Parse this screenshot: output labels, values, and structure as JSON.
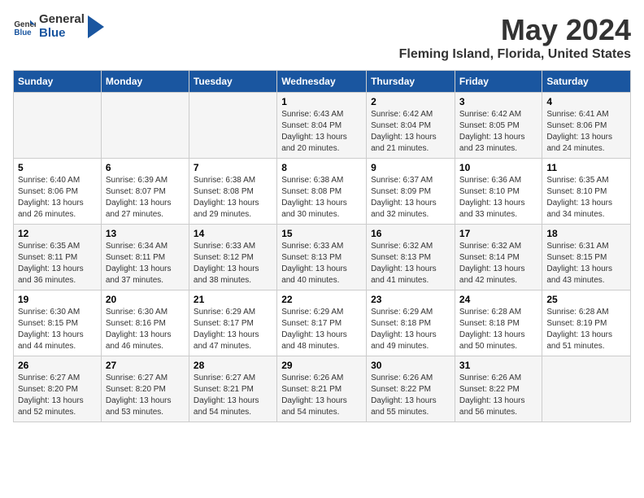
{
  "header": {
    "logo_general": "General",
    "logo_blue": "Blue",
    "title": "May 2024",
    "subtitle": "Fleming Island, Florida, United States"
  },
  "weekdays": [
    "Sunday",
    "Monday",
    "Tuesday",
    "Wednesday",
    "Thursday",
    "Friday",
    "Saturday"
  ],
  "weeks": [
    [
      {
        "day": "",
        "info": ""
      },
      {
        "day": "",
        "info": ""
      },
      {
        "day": "",
        "info": ""
      },
      {
        "day": "1",
        "info": "Sunrise: 6:43 AM\nSunset: 8:04 PM\nDaylight: 13 hours and 20 minutes."
      },
      {
        "day": "2",
        "info": "Sunrise: 6:42 AM\nSunset: 8:04 PM\nDaylight: 13 hours and 21 minutes."
      },
      {
        "day": "3",
        "info": "Sunrise: 6:42 AM\nSunset: 8:05 PM\nDaylight: 13 hours and 23 minutes."
      },
      {
        "day": "4",
        "info": "Sunrise: 6:41 AM\nSunset: 8:06 PM\nDaylight: 13 hours and 24 minutes."
      }
    ],
    [
      {
        "day": "5",
        "info": "Sunrise: 6:40 AM\nSunset: 8:06 PM\nDaylight: 13 hours and 26 minutes."
      },
      {
        "day": "6",
        "info": "Sunrise: 6:39 AM\nSunset: 8:07 PM\nDaylight: 13 hours and 27 minutes."
      },
      {
        "day": "7",
        "info": "Sunrise: 6:38 AM\nSunset: 8:08 PM\nDaylight: 13 hours and 29 minutes."
      },
      {
        "day": "8",
        "info": "Sunrise: 6:38 AM\nSunset: 8:08 PM\nDaylight: 13 hours and 30 minutes."
      },
      {
        "day": "9",
        "info": "Sunrise: 6:37 AM\nSunset: 8:09 PM\nDaylight: 13 hours and 32 minutes."
      },
      {
        "day": "10",
        "info": "Sunrise: 6:36 AM\nSunset: 8:10 PM\nDaylight: 13 hours and 33 minutes."
      },
      {
        "day": "11",
        "info": "Sunrise: 6:35 AM\nSunset: 8:10 PM\nDaylight: 13 hours and 34 minutes."
      }
    ],
    [
      {
        "day": "12",
        "info": "Sunrise: 6:35 AM\nSunset: 8:11 PM\nDaylight: 13 hours and 36 minutes."
      },
      {
        "day": "13",
        "info": "Sunrise: 6:34 AM\nSunset: 8:11 PM\nDaylight: 13 hours and 37 minutes."
      },
      {
        "day": "14",
        "info": "Sunrise: 6:33 AM\nSunset: 8:12 PM\nDaylight: 13 hours and 38 minutes."
      },
      {
        "day": "15",
        "info": "Sunrise: 6:33 AM\nSunset: 8:13 PM\nDaylight: 13 hours and 40 minutes."
      },
      {
        "day": "16",
        "info": "Sunrise: 6:32 AM\nSunset: 8:13 PM\nDaylight: 13 hours and 41 minutes."
      },
      {
        "day": "17",
        "info": "Sunrise: 6:32 AM\nSunset: 8:14 PM\nDaylight: 13 hours and 42 minutes."
      },
      {
        "day": "18",
        "info": "Sunrise: 6:31 AM\nSunset: 8:15 PM\nDaylight: 13 hours and 43 minutes."
      }
    ],
    [
      {
        "day": "19",
        "info": "Sunrise: 6:30 AM\nSunset: 8:15 PM\nDaylight: 13 hours and 44 minutes."
      },
      {
        "day": "20",
        "info": "Sunrise: 6:30 AM\nSunset: 8:16 PM\nDaylight: 13 hours and 46 minutes."
      },
      {
        "day": "21",
        "info": "Sunrise: 6:29 AM\nSunset: 8:17 PM\nDaylight: 13 hours and 47 minutes."
      },
      {
        "day": "22",
        "info": "Sunrise: 6:29 AM\nSunset: 8:17 PM\nDaylight: 13 hours and 48 minutes."
      },
      {
        "day": "23",
        "info": "Sunrise: 6:29 AM\nSunset: 8:18 PM\nDaylight: 13 hours and 49 minutes."
      },
      {
        "day": "24",
        "info": "Sunrise: 6:28 AM\nSunset: 8:18 PM\nDaylight: 13 hours and 50 minutes."
      },
      {
        "day": "25",
        "info": "Sunrise: 6:28 AM\nSunset: 8:19 PM\nDaylight: 13 hours and 51 minutes."
      }
    ],
    [
      {
        "day": "26",
        "info": "Sunrise: 6:27 AM\nSunset: 8:20 PM\nDaylight: 13 hours and 52 minutes."
      },
      {
        "day": "27",
        "info": "Sunrise: 6:27 AM\nSunset: 8:20 PM\nDaylight: 13 hours and 53 minutes."
      },
      {
        "day": "28",
        "info": "Sunrise: 6:27 AM\nSunset: 8:21 PM\nDaylight: 13 hours and 54 minutes."
      },
      {
        "day": "29",
        "info": "Sunrise: 6:26 AM\nSunset: 8:21 PM\nDaylight: 13 hours and 54 minutes."
      },
      {
        "day": "30",
        "info": "Sunrise: 6:26 AM\nSunset: 8:22 PM\nDaylight: 13 hours and 55 minutes."
      },
      {
        "day": "31",
        "info": "Sunrise: 6:26 AM\nSunset: 8:22 PM\nDaylight: 13 hours and 56 minutes."
      },
      {
        "day": "",
        "info": ""
      }
    ]
  ],
  "colors": {
    "header_bg": "#1a56a0",
    "header_text": "#ffffff",
    "title_color": "#333333"
  }
}
